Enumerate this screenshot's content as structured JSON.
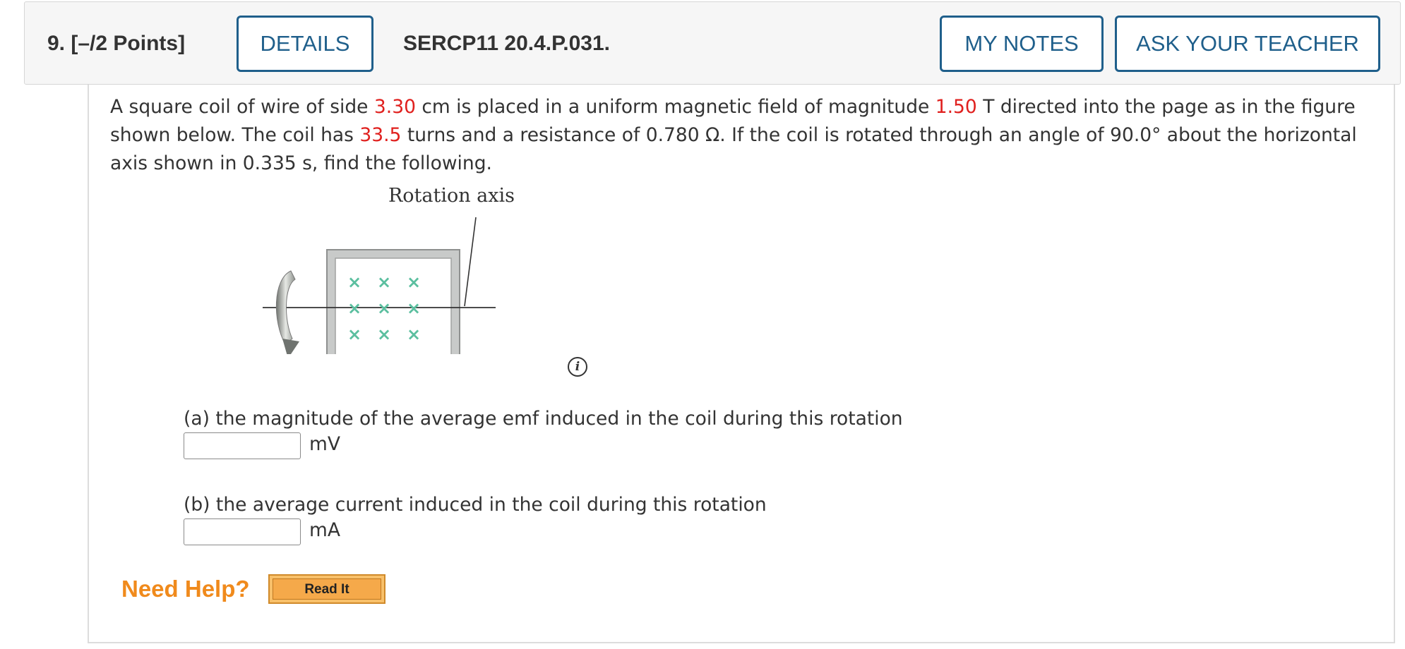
{
  "header": {
    "question_number": "9.",
    "points": "[–/2 Points]",
    "details_label": "DETAILS",
    "problem_code": "SERCP11 20.4.P.031.",
    "my_notes_label": "MY NOTES",
    "ask_teacher_label": "ASK YOUR TEACHER"
  },
  "problem": {
    "seg1": "A square coil of wire of side ",
    "side_value": "3.30",
    "seg2": " cm is placed in a uniform magnetic field of magnitude ",
    "field_value": "1.50",
    "seg3": " T directed into the page as in the figure shown below. The coil has ",
    "turns_value": "33.5",
    "seg4": " turns and a resistance of 0.780 Ω. If the coil is rotated through an angle of 90.0° about the horizontal axis shown in 0.335 s, find the following."
  },
  "figure": {
    "rotation_axis_label": "Rotation axis",
    "field_symbol": "×",
    "info_symbol": "i"
  },
  "parts": [
    {
      "label": "(a) the magnitude of the average emf induced in the coil during this rotation",
      "unit": "mV",
      "value": ""
    },
    {
      "label": "(b) the average current induced in the coil during this rotation",
      "unit": "mA",
      "value": ""
    }
  ],
  "help": {
    "need_help_label": "Need Help?",
    "read_it_label": "Read It"
  },
  "colors": {
    "accent_blue": "#1f5f8b",
    "given_value_red": "#e0201e",
    "help_orange": "#f08a1c",
    "field_cross_green": "#5bbf9f"
  }
}
